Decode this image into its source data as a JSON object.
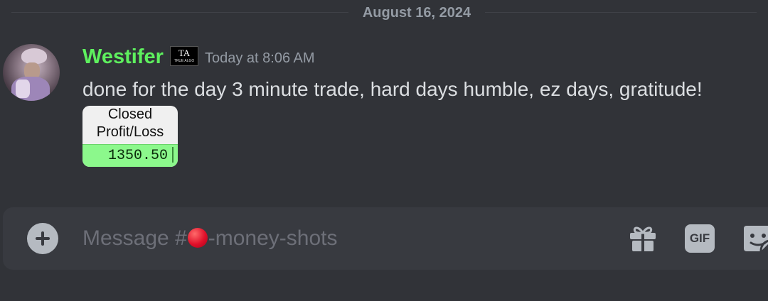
{
  "divider": {
    "date": "August 16, 2024"
  },
  "message": {
    "username": "Westifer",
    "username_color": "#5ef05e",
    "role_badge": {
      "mark": "TA",
      "sub": "TRUE ALGO"
    },
    "timestamp": "Today at 8:06 AM",
    "content": "done for the day 3 minute trade, hard days humble, ez days, gratitude!",
    "attachment": {
      "header_line1": "Closed",
      "header_line2": "Profit/Loss",
      "value": "1350.50",
      "value_bg": "#8cf88c"
    }
  },
  "composer": {
    "placeholder_prefix": "Message #",
    "channel_emoji": "red-circle",
    "placeholder_suffix": "-money-shots",
    "icons": [
      "add-icon",
      "gift-icon",
      "gif-icon",
      "sticker-icon"
    ],
    "gif_label": "GIF"
  },
  "colors": {
    "background": "#313338",
    "composer_bg": "#383a40",
    "muted_text": "#949ba4",
    "body_text": "#dbdee1"
  }
}
